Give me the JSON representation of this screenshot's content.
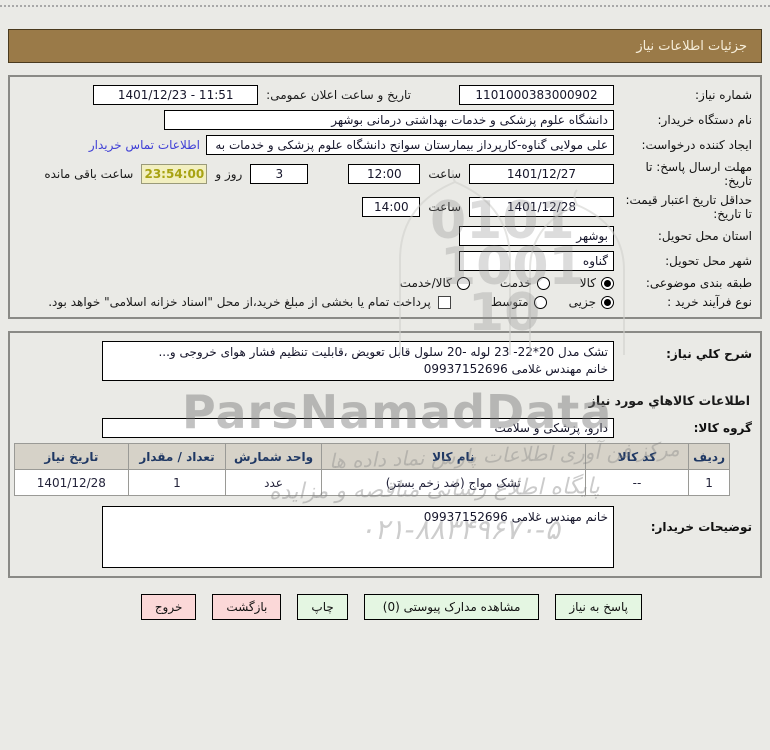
{
  "header": {
    "title": "جزئیات اطلاعات نیاز"
  },
  "section1": {
    "need_number": {
      "label": "شماره نیاز:",
      "value": "1101000383000902"
    },
    "announce": {
      "label": "تاریخ و ساعت اعلان عمومی:",
      "value": "1401/12/23 - 11:51"
    },
    "buyer_org": {
      "label": "نام دستگاه خریدار:",
      "value": "دانشگاه علوم پزشکی و خدمات بهداشتی درمانی بوشهر"
    },
    "creator": {
      "label": "ایجاد کننده درخواست:",
      "value": "علی مولایی گناوه-کارپرداز بیمارستان سوانح دانشگاه علوم پزشکی و خدمات به",
      "contact_link": "اطلاعات تماس خریدار"
    },
    "deadline": {
      "label": "مهلت ارسال پاسخ: تا تاریخ:",
      "date": "1401/12/27",
      "hour_label": "ساعت",
      "time": "12:00",
      "days": "3",
      "days_label": "روز و",
      "countdown": "23:54:00",
      "remain_label": "ساعت باقی مانده"
    },
    "validity": {
      "label": "حداقل تاریخ اعتبار قیمت: تا تاریخ:",
      "date": "1401/12/28",
      "hour_label": "ساعت",
      "time": "14:00"
    },
    "province": {
      "label": "استان محل تحویل:",
      "value": "بوشهر"
    },
    "city": {
      "label": "شهر محل تحویل:",
      "value": "گناوه"
    },
    "classification": {
      "label": "طبقه بندی موضوعی:",
      "options": [
        {
          "label": "کالا",
          "selected": true
        },
        {
          "label": "خدمت",
          "selected": false
        },
        {
          "label": "کالا/خدمت",
          "selected": false
        }
      ]
    },
    "process": {
      "label": "نوع فرآیند خرید :",
      "options": [
        {
          "label": "جزیی",
          "selected": true
        },
        {
          "label": "متوسط",
          "selected": false
        }
      ],
      "checkbox_label": "پرداخت تمام یا بخشی از مبلغ خرید،از محل \"اسناد خزانه اسلامی\" خواهد بود.",
      "checkbox_checked": false
    }
  },
  "section2": {
    "description": {
      "label": "شرح کلي نياز:",
      "line1": "تشک مدل 20*22- 23 لوله -20 سلول قابل تعویض ،قابلیت تنظیم فشار هوای خروجی و...",
      "line2": "خانم مهندس غلامی 09937152696"
    },
    "goods_header": "اطلاعات کالاهاي مورد نياز",
    "group": {
      "label": "گروه کالا:",
      "value": "دارو، پزشکی و سلامت"
    },
    "table": {
      "headers": [
        "ردیف",
        "کد کالا",
        "نام کالا",
        "واحد شمارش",
        "تعداد / مقدار",
        "تاریخ نیاز"
      ],
      "rows": [
        {
          "cells": [
            "1",
            "--",
            "تشک مواج (ضد زخم بستر)",
            "عدد",
            "1",
            "1401/12/28"
          ]
        }
      ]
    },
    "buyer_notes": {
      "label": "توضیحات خریدار:",
      "value": "خانم مهندس غلامی 09937152696"
    }
  },
  "footer": {
    "buttons": [
      {
        "label": "پاسخ به نیاز",
        "style": "green"
      },
      {
        "label": "مشاهده مدارک پیوستی (0)",
        "style": "green"
      },
      {
        "label": "چاپ",
        "style": "green"
      },
      {
        "label": "بازگشت",
        "style": "pink"
      },
      {
        "label": "خروج",
        "style": "pink"
      }
    ]
  },
  "watermark": {
    "brand": "ParsNamadData",
    "line1": "مرکز فن آوری اطلاعات پارس نماد داده ها",
    "line2": "پایگاه اطلاع رسانی مناقصه و مزایده",
    "phone": "۰۲۱-۸۸۳۴۹۶۷۰-۵",
    "digits": [
      "0101",
      "1001",
      "10"
    ]
  },
  "colors": {
    "header_bg": "#9a7a48",
    "countdown_bg": "#f2efc0",
    "countdown_text": "#a8a312",
    "link": "#3f3fd6",
    "button_green": "#e4f6e2",
    "button_pink": "#fbd8d8",
    "table_header_bg": "#d6d2c8"
  }
}
